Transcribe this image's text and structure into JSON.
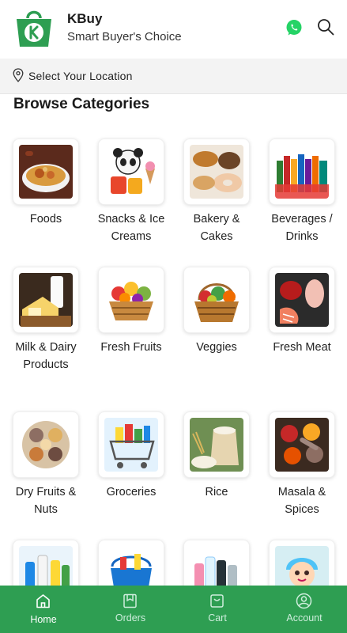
{
  "header": {
    "brand_name": "KBuy",
    "tagline": "Smart Buyer's Choice",
    "logo_icon": "shopping-bag-k-logo",
    "whatsapp_icon": "whatsapp-icon",
    "search_icon": "search-icon"
  },
  "location": {
    "label": "Select Your Location",
    "icon": "map-pin-icon"
  },
  "section_title": "Browse Categories",
  "categories": [
    {
      "label": "Foods"
    },
    {
      "label": "Snacks & Ice Creams"
    },
    {
      "label": "Bakery & Cakes"
    },
    {
      "label": "Beverages / Drinks"
    },
    {
      "label": "Milk & Dairy Products"
    },
    {
      "label": "Fresh Fruits"
    },
    {
      "label": "Veggies"
    },
    {
      "label": "Fresh Meat"
    },
    {
      "label": "Dry Fruits & Nuts"
    },
    {
      "label": "Groceries"
    },
    {
      "label": "Rice"
    },
    {
      "label": "Masala & Spices"
    },
    {
      "label": ""
    },
    {
      "label": ""
    },
    {
      "label": ""
    },
    {
      "label": ""
    }
  ],
  "bottom_nav": {
    "items": [
      {
        "label": "Home",
        "icon": "home-icon",
        "active": true
      },
      {
        "label": "Orders",
        "icon": "orders-icon",
        "active": false
      },
      {
        "label": "Cart",
        "icon": "cart-icon",
        "active": false
      },
      {
        "label": "Account",
        "icon": "account-icon",
        "active": false
      }
    ]
  },
  "colors": {
    "brand_green": "#2e9e52",
    "whatsapp_green": "#25d366"
  }
}
